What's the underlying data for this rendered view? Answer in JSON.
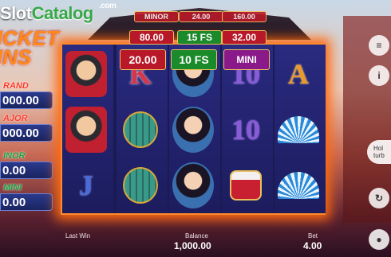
{
  "logo": {
    "slot": "Slot",
    "catalog": "Catalog",
    "com": ".com"
  },
  "game": {
    "title_line1": "ICKET",
    "title_line2": "INS"
  },
  "jackpots": [
    {
      "label": "RAND",
      "value": "000.00"
    },
    {
      "label": "AJOR",
      "value": "000.00"
    },
    {
      "label": "INOR",
      "value": "0.00"
    },
    {
      "label": "MINI",
      "value": "0.00"
    }
  ],
  "top_panel": {
    "small_tabs": [
      "MINOR",
      "24.00",
      "160.00"
    ],
    "row2": [
      "80.00",
      "15 FS",
      "32.00"
    ],
    "row3": [
      "20.00",
      "10 FS",
      "MINI"
    ]
  },
  "reels": {
    "reel1": [
      "man",
      "man",
      "J"
    ],
    "reel2": [
      "K",
      "lantern",
      "lantern"
    ],
    "reel3": [
      "woman",
      "woman",
      "woman"
    ],
    "reel4": [
      "10",
      "10",
      "drum"
    ],
    "reel5": [
      "A",
      "fan",
      "fan"
    ]
  },
  "bottom": {
    "last_win_label": "Last Win",
    "balance_label": "Balance",
    "balance_value": "1,000.00",
    "bet_label": "Bet",
    "bet_value": "4.00"
  },
  "side": {
    "hold_text_1": "Hol",
    "hold_text_2": "turb"
  }
}
